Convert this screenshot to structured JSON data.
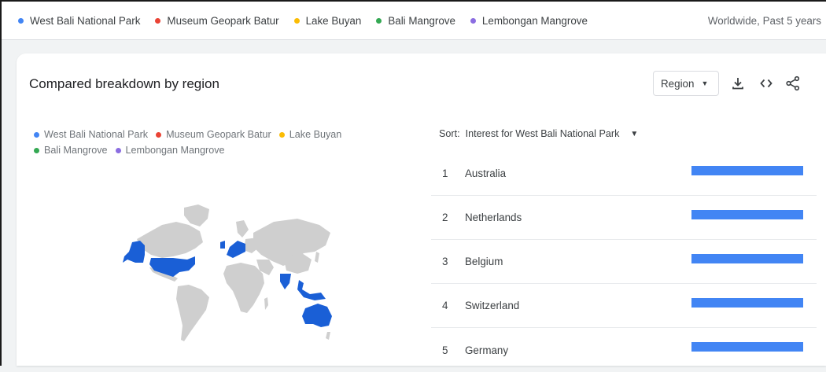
{
  "top_legend": {
    "terms": [
      {
        "label": "West Bali National Park",
        "color": "#4285f4"
      },
      {
        "label": "Museum Geopark Batur",
        "color": "#ea4335"
      },
      {
        "label": "Lake Buyan",
        "color": "#fbbc04"
      },
      {
        "label": "Bali Mangrove",
        "color": "#34a853"
      },
      {
        "label": "Lembongan Mangrove",
        "color": "#8b6de1"
      }
    ],
    "meta": "Worldwide, Past 5 years"
  },
  "card": {
    "title": "Compared breakdown by region",
    "region_button": "Region",
    "icons": [
      "download-icon",
      "embed-code-icon",
      "share-icon"
    ]
  },
  "legend": {
    "row1": [
      "West Bali National Park",
      "Museum Geopark Batur",
      "Lake Buyan"
    ],
    "row2": [
      "Bali Mangrove",
      "Lembongan Mangrove"
    ]
  },
  "map": {
    "highlight_color": "#1a5fd6",
    "base_color": "#cfcfcf",
    "highlighted_regions": [
      "Alaska",
      "United States",
      "Western Europe",
      "India",
      "Southeast Asia",
      "Australia"
    ]
  },
  "sort": {
    "label": "Sort:",
    "value": "Interest for West Bali National Park"
  },
  "ranking": [
    {
      "rank": "1",
      "country": "Australia",
      "bar_fraction": 1.0
    },
    {
      "rank": "2",
      "country": "Netherlands",
      "bar_fraction": 1.0
    },
    {
      "rank": "3",
      "country": "Belgium",
      "bar_fraction": 1.0
    },
    {
      "rank": "4",
      "country": "Switzerland",
      "bar_fraction": 1.0
    },
    {
      "rank": "5",
      "country": "Germany",
      "bar_fraction": 1.0
    }
  ]
}
